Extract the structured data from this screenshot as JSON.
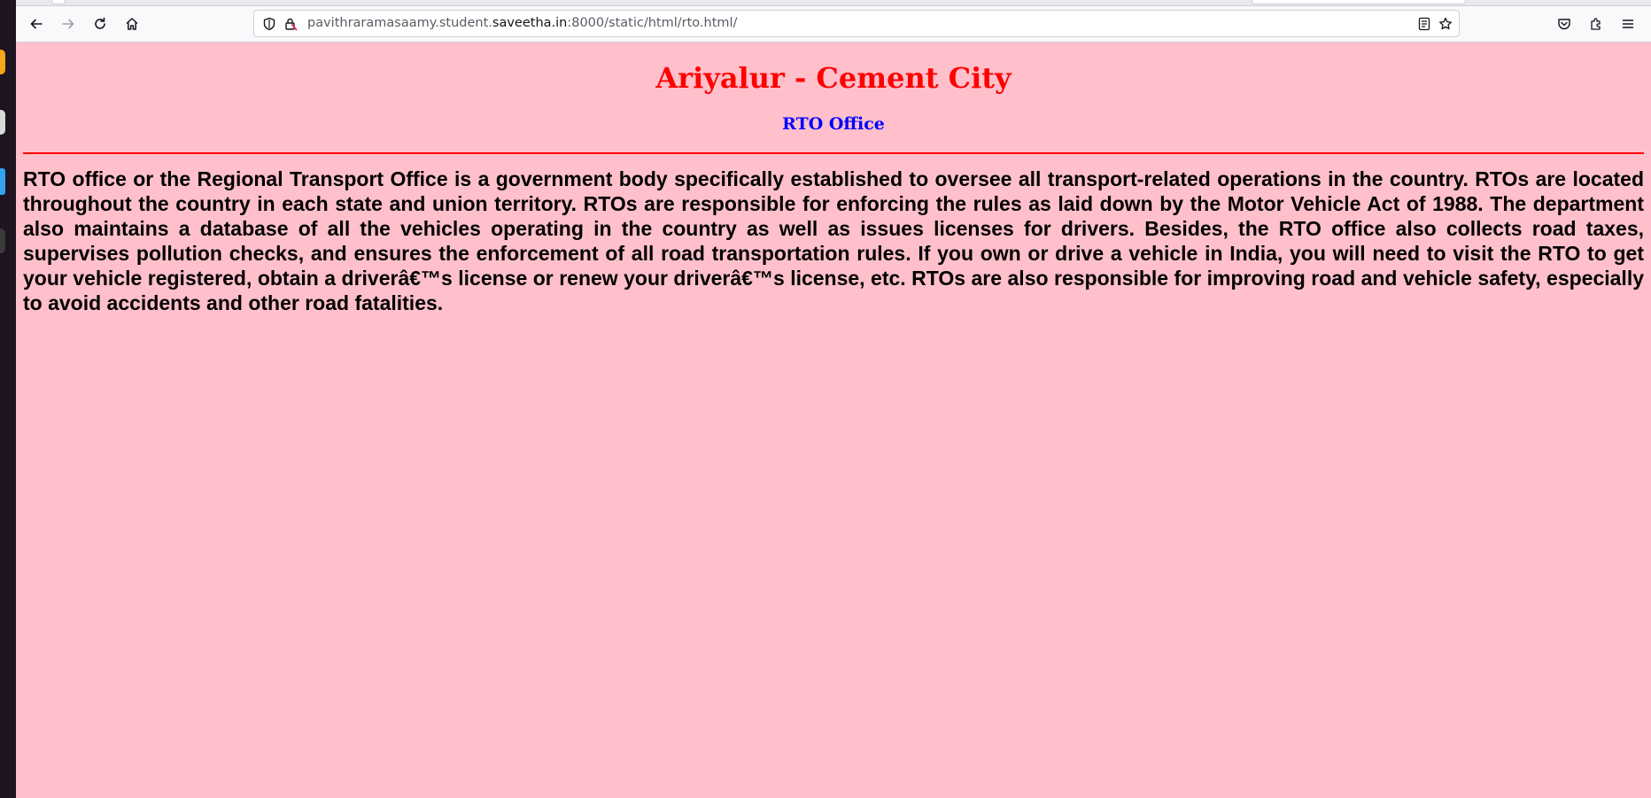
{
  "browser": {
    "url_prefix": "pavithraramasaamy.student.",
    "url_host": "saveetha.in",
    "url_suffix": ":8000/static/html/rto.html/",
    "icons": {
      "back": "arrow-left-icon",
      "forward": "arrow-right-icon",
      "reload": "reload-icon",
      "home": "home-icon",
      "tracking": "shield-icon",
      "permissions": "lock-warning-icon",
      "reader": "reader-view-icon",
      "bookmark": "star-icon",
      "pocket": "pocket-icon",
      "extensions": "puzzle-icon",
      "menu": "hamburger-menu-icon"
    }
  },
  "page": {
    "title": "Ariyalur - Cement City",
    "subtitle": "RTO Office",
    "paragraph": "RTO office or the Regional Transport Office is a government body specifically established to oversee all transport-related operations in the country. RTOs are located throughout the country in each state and union territory. RTOs are responsible for enforcing the rules as laid down by the Motor Vehicle Act of 1988. The department also maintains a database of all the vehicles operating in the country as well as issues licenses for drivers. Besides, the RTO office also collects road taxes, supervises pollution checks, and ensures the enforcement of all road transportation rules. If you own or drive a vehicle in India, you will need to visit the RTO to get your vehicle registered, obtain a driverâ€™s license or renew your driverâ€™s license, etc. RTOs are also responsible for improving road and vehicle safety, especially to avoid accidents and other road fatalities."
  },
  "colors": {
    "page_background": "#ffc0cb",
    "title": "#ff0000",
    "subtitle": "#0000ff",
    "rule": "#ff0000",
    "text": "#000000"
  }
}
